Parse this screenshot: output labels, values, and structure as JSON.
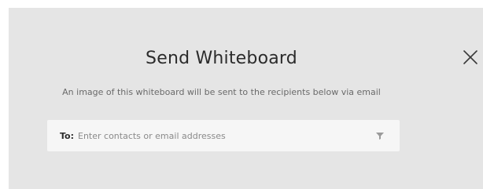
{
  "dialog": {
    "title": "Send Whiteboard",
    "subtitle": "An image of this whiteboard will be sent to the recipients below via email",
    "close_icon": "close-icon",
    "recipients": {
      "label": "To:",
      "value": "",
      "placeholder": "Enter contacts or email addresses",
      "filter_icon": "funnel-icon"
    }
  },
  "colors": {
    "dialog_background": "#e5e5e5",
    "field_background": "#f6f6f6",
    "title_text": "#2b2b2b",
    "secondary_text": "#6a6a6a",
    "placeholder_text": "#8a8a8a"
  }
}
